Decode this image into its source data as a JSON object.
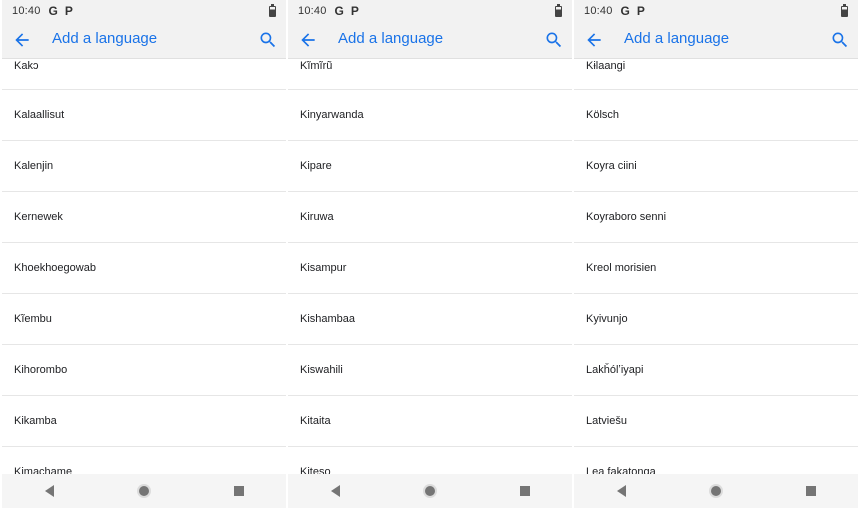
{
  "status_bar": {
    "time": "10:40",
    "g_label": "G",
    "p_label": "P"
  },
  "app_bar": {
    "title": "Add a language"
  },
  "screens": [
    {
      "items": [
        "Kakɔ",
        "Kalaallisut",
        "Kalenjin",
        "Kernewek",
        "Khoekhoegowab",
        "Kĩembu",
        "Kihorombo",
        "Kikamba",
        "Kimachame"
      ]
    },
    {
      "items": [
        "Kĩmĩrũ",
        "Kinyarwanda",
        "Kipare",
        "Kiruwa",
        "Kisampur",
        "Kishambaa",
        "Kiswahili",
        "Kitaita",
        "Kiteso"
      ]
    },
    {
      "items": [
        "Kɨlaangi",
        "Kölsch",
        "Koyra ciini",
        "Koyraboro senni",
        "Kreol morisien",
        "Kyivunjo",
        "Lakȟólʼiyapi",
        "Latviešu",
        "Lea fakatonga"
      ]
    }
  ],
  "icons": {
    "back": "arrow-back-icon",
    "search": "search-icon",
    "battery": "battery-icon",
    "nav_back": "nav-back-icon",
    "nav_home": "nav-home-icon",
    "nav_recents": "nav-recents-icon"
  },
  "colors": {
    "accent": "#1a73e8",
    "app_bar_bg": "#f2f2f2",
    "divider": "#e6e6e6"
  }
}
